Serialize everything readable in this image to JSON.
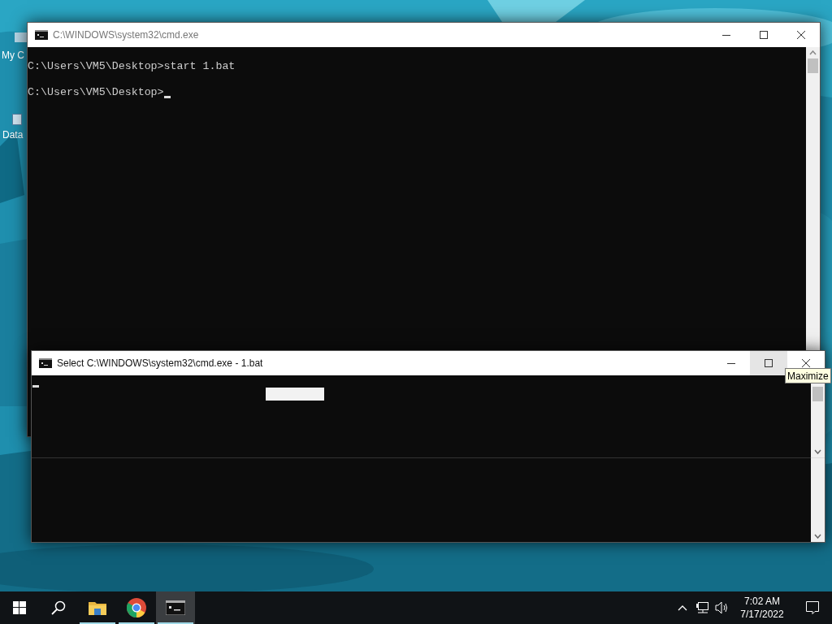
{
  "desktop_icons": [
    {
      "label": "My C"
    },
    {
      "label": "Data"
    }
  ],
  "windows": [
    {
      "title": "C:\\WINDOWS\\system32\\cmd.exe",
      "lines": [
        "C:\\Users\\VM5\\Desktop>start 1.bat",
        "C:\\Users\\VM5\\Desktop>"
      ],
      "cursor": true,
      "selection_block": false,
      "split": false,
      "buttons": [
        {
          "kind": "minimize",
          "hovered": false
        },
        {
          "kind": "maximize",
          "hovered": false
        },
        {
          "kind": "close",
          "hovered": false
        }
      ]
    },
    {
      "title": "Select C:\\WINDOWS\\system32\\cmd.exe - 1.bat",
      "cursor": true,
      "selection_block": true,
      "split": true,
      "buttons": [
        {
          "kind": "minimize",
          "hovered": false
        },
        {
          "kind": "maximize",
          "hovered": true
        },
        {
          "kind": "close",
          "hovered": false
        }
      ]
    }
  ],
  "tooltip": {
    "text": "Maximize"
  },
  "taskbar": {
    "items": [
      {
        "kind": "start",
        "running": false,
        "active": false
      },
      {
        "kind": "search",
        "running": false,
        "active": false
      },
      {
        "kind": "folder",
        "running": true,
        "active": false
      },
      {
        "kind": "chrome",
        "running": true,
        "active": false
      },
      {
        "kind": "console",
        "running": true,
        "active": true
      }
    ],
    "tray": [
      {
        "kind": "chevron"
      },
      {
        "kind": "network"
      },
      {
        "kind": "volume"
      }
    ],
    "time": "7:02 AM",
    "date": "7/17/2022"
  }
}
